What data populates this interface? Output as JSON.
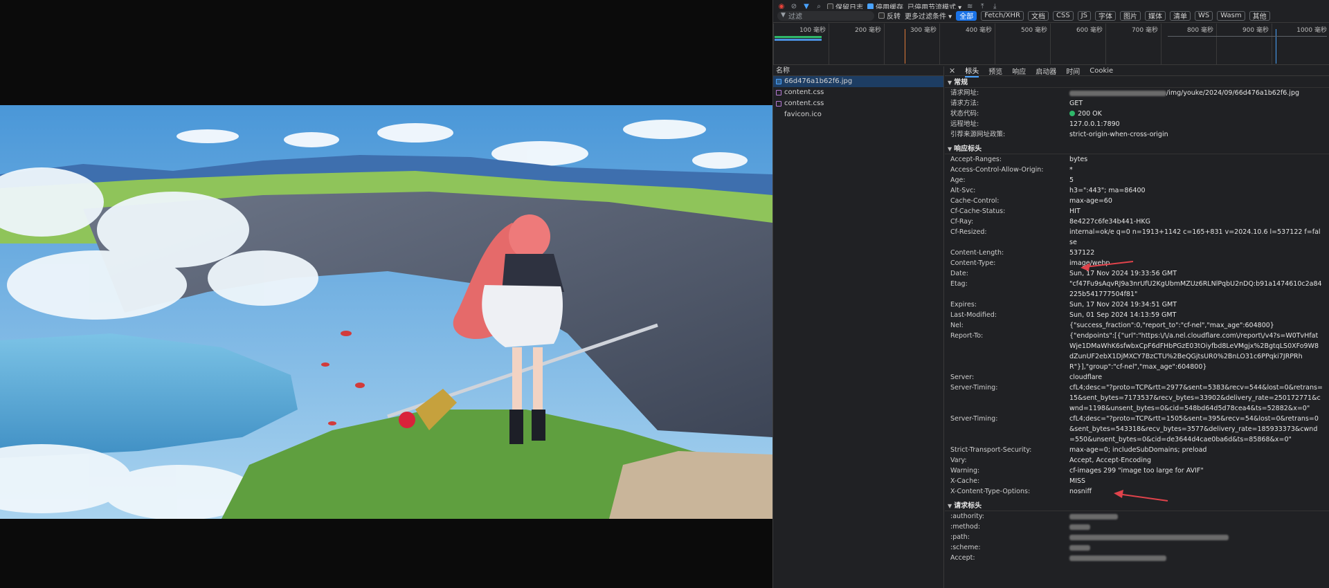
{
  "toolbar": {
    "preserve_log_label": "保留日志",
    "disable_cache_label": "停用缓存",
    "throttling_label": "已停用节流模式",
    "filter_placeholder": "过滤",
    "invert_label": "反转",
    "more_filters_label": "更多过滤条件",
    "type_filters": [
      "全部",
      "Fetch/XHR",
      "文档",
      "CSS",
      "JS",
      "字体",
      "图片",
      "媒体",
      "清单",
      "WS",
      "Wasm",
      "其他"
    ]
  },
  "overview": {
    "tick_labels": [
      "100 毫秒",
      "200 毫秒",
      "300 毫秒",
      "400 毫秒",
      "500 毫秒",
      "600 毫秒",
      "700 毫秒",
      "800 毫秒",
      "900 毫秒",
      "1000 毫秒"
    ]
  },
  "request_list": {
    "header": "名称",
    "items": [
      {
        "name": "66d476a1b62f6.jpg",
        "type": "img"
      },
      {
        "name": "content.css",
        "type": "css"
      },
      {
        "name": "content.css",
        "type": "css"
      },
      {
        "name": "favicon.ico",
        "type": "blank"
      }
    ]
  },
  "detail": {
    "tabs": [
      "标头",
      "预览",
      "响应",
      "启动器",
      "时间",
      "Cookie"
    ],
    "general": {
      "title": "常规",
      "rows": [
        {
          "k": "请求网址:",
          "v": "/img/youke/2024/09/66d476a1b62f6.jpg"
        },
        {
          "k": "请求方法:",
          "v": "GET"
        },
        {
          "k": "状态代码:",
          "v": "200 OK"
        },
        {
          "k": "远程地址:",
          "v": "127.0.0.1:7890"
        },
        {
          "k": "引荐来源网址政策:",
          "v": "strict-origin-when-cross-origin"
        }
      ]
    },
    "response_headers": {
      "title": "响应标头",
      "rows": [
        {
          "k": "Accept-Ranges:",
          "v": "bytes"
        },
        {
          "k": "Access-Control-Allow-Origin:",
          "v": "*"
        },
        {
          "k": "Age:",
          "v": "5"
        },
        {
          "k": "Alt-Svc:",
          "v": "h3=\":443\"; ma=86400"
        },
        {
          "k": "Cache-Control:",
          "v": "max-age=60"
        },
        {
          "k": "Cf-Cache-Status:",
          "v": "HIT"
        },
        {
          "k": "Cf-Ray:",
          "v": "8e4227c6fe34b441-HKG"
        },
        {
          "k": "Cf-Resized:",
          "v": "internal=ok/e q=0 n=1913+1142 c=165+831 v=2024.10.6 l=537122 f=false"
        },
        {
          "k": "Content-Length:",
          "v": "537122"
        },
        {
          "k": "Content-Type:",
          "v": "image/webp"
        },
        {
          "k": "Date:",
          "v": "Sun, 17 Nov 2024 19:33:56 GMT"
        },
        {
          "k": "Etag:",
          "v": "\"cf47Fu9sAqvRJ9a3nrUfU2KgUbmMZUz6RLNlPqbU2nDQ:b91a1474610c2a84225b541777504f81\""
        },
        {
          "k": "Expires:",
          "v": "Sun, 17 Nov 2024 19:34:51 GMT"
        },
        {
          "k": "Last-Modified:",
          "v": "Sun, 01 Sep 2024 14:13:59 GMT"
        },
        {
          "k": "Nel:",
          "v": "{\"success_fraction\":0,\"report_to\":\"cf-nel\",\"max_age\":604800}"
        },
        {
          "k": "Report-To:",
          "v": "{\"endpoints\":[{\"url\":\"https:\\/\\/a.nel.cloudflare.com\\/report\\/v4?s=W0TvHfatWje1DMaWhK6sfwbxCpF6dFHbPGzE03tOiyfbd8LeVMgjx%2BgtqLS0XFo9W8dZunUF2ebX1DjMXCY7BzCTU%2BeQGjtsUR0%2BnLO31c6PPqki7JRPRhR\"}],\"group\":\"cf-nel\",\"max_age\":604800}"
        },
        {
          "k": "Server:",
          "v": "cloudflare"
        },
        {
          "k": "Server-Timing:",
          "v": "cfL4;desc=\"?proto=TCP&rtt=2977&sent=5383&recv=544&lost=0&retrans=15&sent_bytes=7173537&recv_bytes=33902&delivery_rate=250172771&cwnd=1198&unsent_bytes=0&cid=548bd64d5d78cea4&ts=52882&x=0\""
        },
        {
          "k": "Server-Timing:",
          "v": "cfL4;desc=\"?proto=TCP&rtt=1505&sent=395&recv=54&lost=0&retrans=0&sent_bytes=543318&recv_bytes=3577&delivery_rate=185933373&cwnd=550&unsent_bytes=0&cid=de3644d4cae0ba6d&ts=85868&x=0\""
        },
        {
          "k": "Strict-Transport-Security:",
          "v": "max-age=0; includeSubDomains; preload"
        },
        {
          "k": "Vary:",
          "v": "Accept, Accept-Encoding"
        },
        {
          "k": "Warning:",
          "v": "cf-images 299 \"image too large for AVIF\""
        },
        {
          "k": "X-Cache:",
          "v": "MISS"
        },
        {
          "k": "X-Content-Type-Options:",
          "v": "nosniff"
        }
      ]
    },
    "request_headers": {
      "title": "请求标头",
      "rows": [
        {
          "k": ":authority:"
        },
        {
          "k": ":method:"
        },
        {
          "k": ":path:"
        },
        {
          "k": ":scheme:"
        },
        {
          "k": "Accept:"
        }
      ]
    }
  },
  "colors": {
    "accent": "#1a73e8",
    "status_ok": "#2fb86a",
    "annotation_arrow": "#e0434b"
  }
}
